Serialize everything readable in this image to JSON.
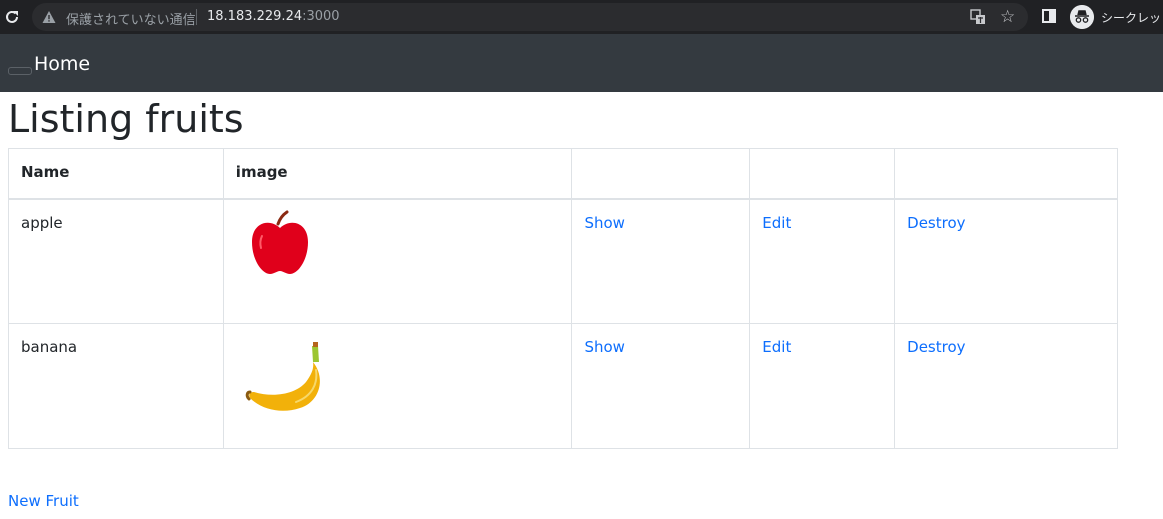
{
  "browser": {
    "security_label": "保護されていない通信",
    "url_host": "18.183.229.24",
    "url_port": ":3000",
    "profile_label": "シークレット",
    "icons": [
      "reload-icon",
      "warning-icon",
      "translate-icon",
      "star-icon",
      "side-panel-icon",
      "incognito-icon"
    ]
  },
  "navbar": {
    "brand": "Home"
  },
  "page": {
    "title": "Listing fruits"
  },
  "table": {
    "headers": [
      "Name",
      "image",
      "",
      "",
      ""
    ],
    "rows": [
      {
        "name": "apple",
        "image": "apple-image",
        "show": "Show",
        "edit": "Edit",
        "destroy": "Destroy"
      },
      {
        "name": "banana",
        "image": "banana-image",
        "show": "Show",
        "edit": "Edit",
        "destroy": "Destroy"
      }
    ]
  },
  "actions": {
    "new_fruit": "New Fruit"
  },
  "colors": {
    "chrome_bg": "#202124",
    "navbar_bg": "#343a40",
    "link": "#0d6efd",
    "apple": "#e0001b",
    "banana": "#f2b10a"
  }
}
